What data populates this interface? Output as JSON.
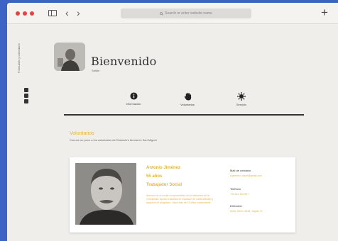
{
  "browser": {
    "address_text": "Search or enter website name",
    "plus_label": "+",
    "back_label": "‹",
    "forward_label": "›"
  },
  "sidebar": {
    "vertical_text": "Formulario y calendario"
  },
  "profile": {
    "welcome": "Bienvenido",
    "username": "Salido"
  },
  "tabs": [
    {
      "label": "Información"
    },
    {
      "label": "Voluntarios"
    },
    {
      "label": "Servicio"
    }
  ],
  "section": {
    "title": "Voluntarios",
    "subtitle": "Conoce un poco a los voluntarios de Rosewin's tienda en San Miguel"
  },
  "volunteer": {
    "name": "Antonio Jiménez",
    "age": "55 años",
    "role": "Trabajador Social",
    "description": "Antonio es un social comprometido con el bienestar de la comunidad. Ayuda a familias en situación de vulnerabilidad y apoya en el programa. Lleva más de 10 años colaborando.",
    "contact_label": "Mail de contacto",
    "contact_value": "a.jimenez.volunt@gmail.com",
    "phone_label": "Teléfono",
    "phone_value": "+34 611 234 567",
    "address_label": "Dirección",
    "address_value": "Avda. Hierro 2048, Jaguar, B."
  },
  "colors": {
    "accent": "#e2b53a",
    "background": "#3d63c4",
    "window": "#efeeea"
  }
}
